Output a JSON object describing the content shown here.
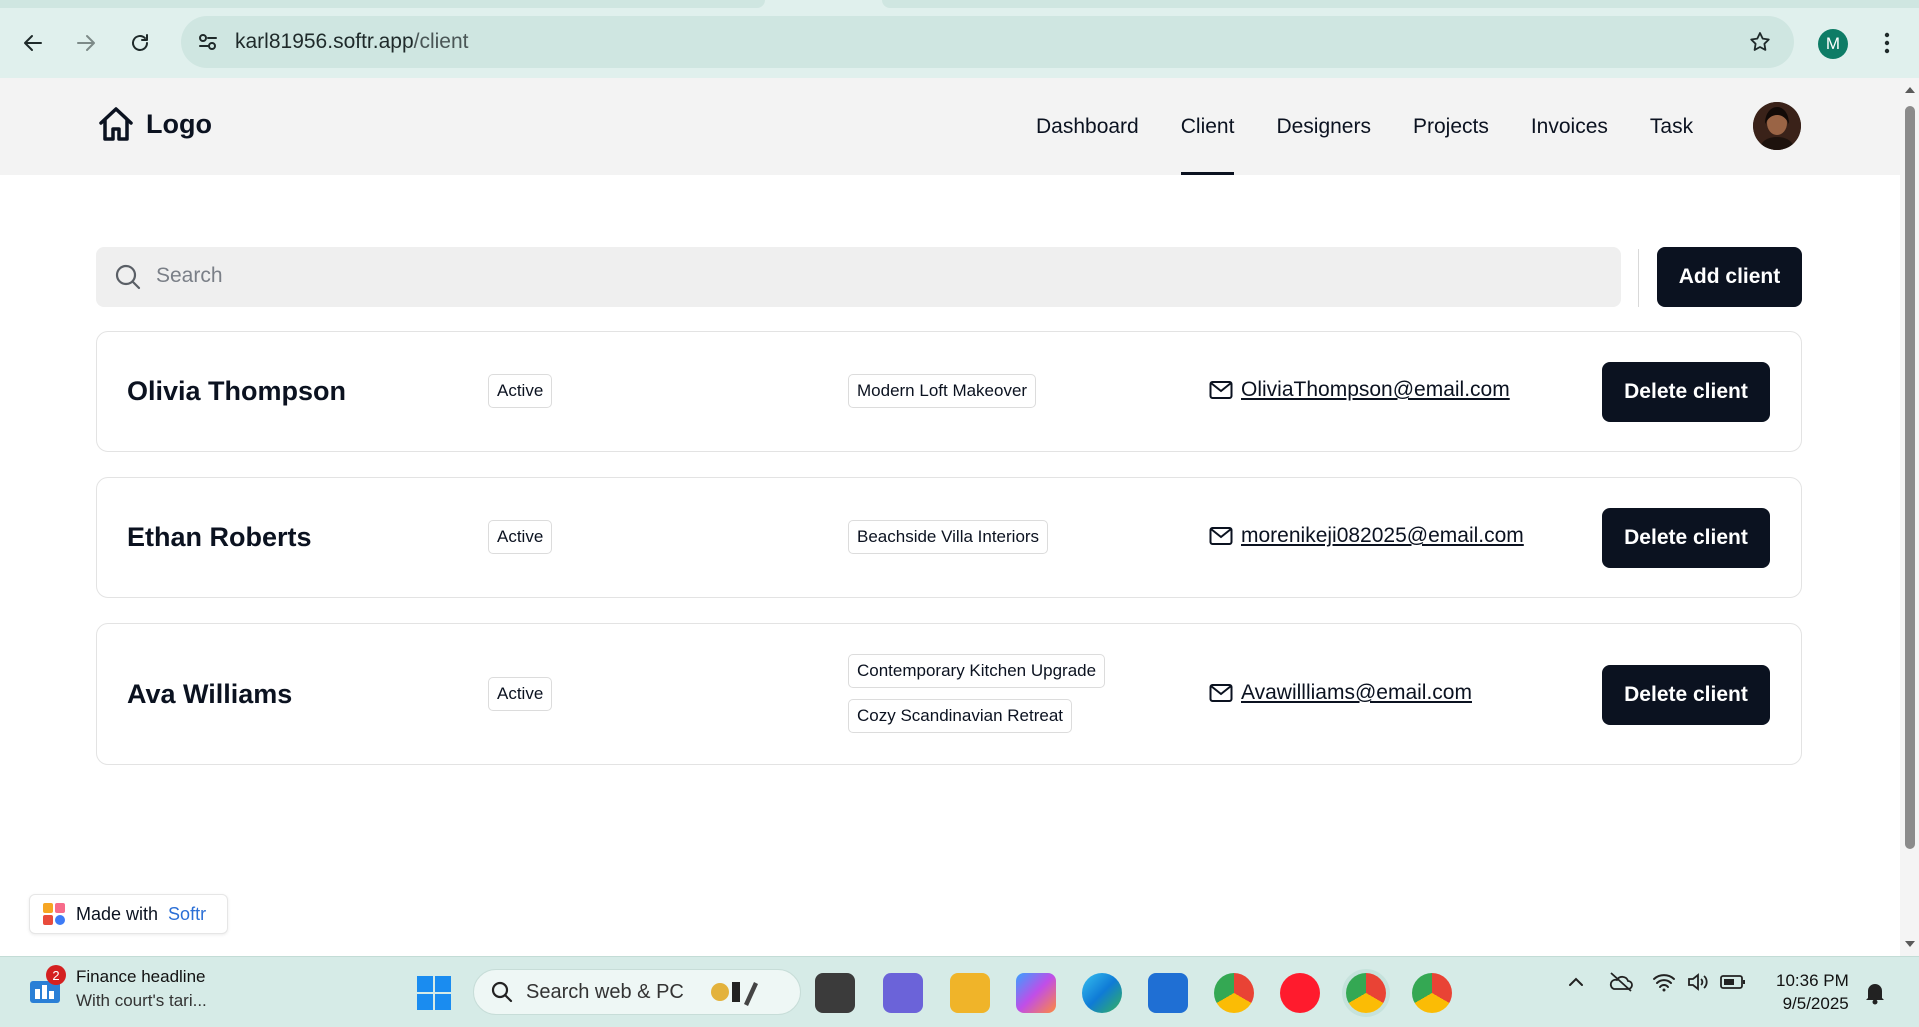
{
  "browser": {
    "url_host": "karl81956.softr.app",
    "url_path": "/client",
    "profile_initial": "M"
  },
  "header": {
    "logo_text": "Logo",
    "nav": [
      "Dashboard",
      "Client",
      "Designers",
      "Projects",
      "Invoices",
      "Task"
    ],
    "active_nav": "Client"
  },
  "toolbar": {
    "search_placeholder": "Search",
    "add_label": "Add client"
  },
  "clients": [
    {
      "name": "Olivia Thompson",
      "status": "Active",
      "projects": [
        "Modern Loft Makeover"
      ],
      "email": "OliviaThompson@email.com",
      "delete_label": "Delete client"
    },
    {
      "name": "Ethan Roberts",
      "status": "Active",
      "projects": [
        "Beachside Villa Interiors"
      ],
      "email": "morenikeji082025@email.com",
      "delete_label": "Delete client"
    },
    {
      "name": "Ava Williams",
      "status": "Active",
      "projects": [
        "Contemporary Kitchen Upgrade",
        "Cozy Scandinavian Retreat"
      ],
      "email": "Avawillliams@email.com",
      "delete_label": "Delete client"
    }
  ],
  "badge": {
    "prefix": "Made with",
    "brand": "Softr"
  },
  "taskbar": {
    "news_title": "Finance headline",
    "news_sub": "With court's tari...",
    "news_badge": "2",
    "search_placeholder": "Search web & PC",
    "time": "10:36 PM",
    "date": "9/5/2025"
  },
  "colors": {
    "primary": "#0b1220",
    "chrome_bg": "#e0f0ed",
    "header_bg": "#f3f3f3",
    "brand_link": "#2b6fd6"
  }
}
